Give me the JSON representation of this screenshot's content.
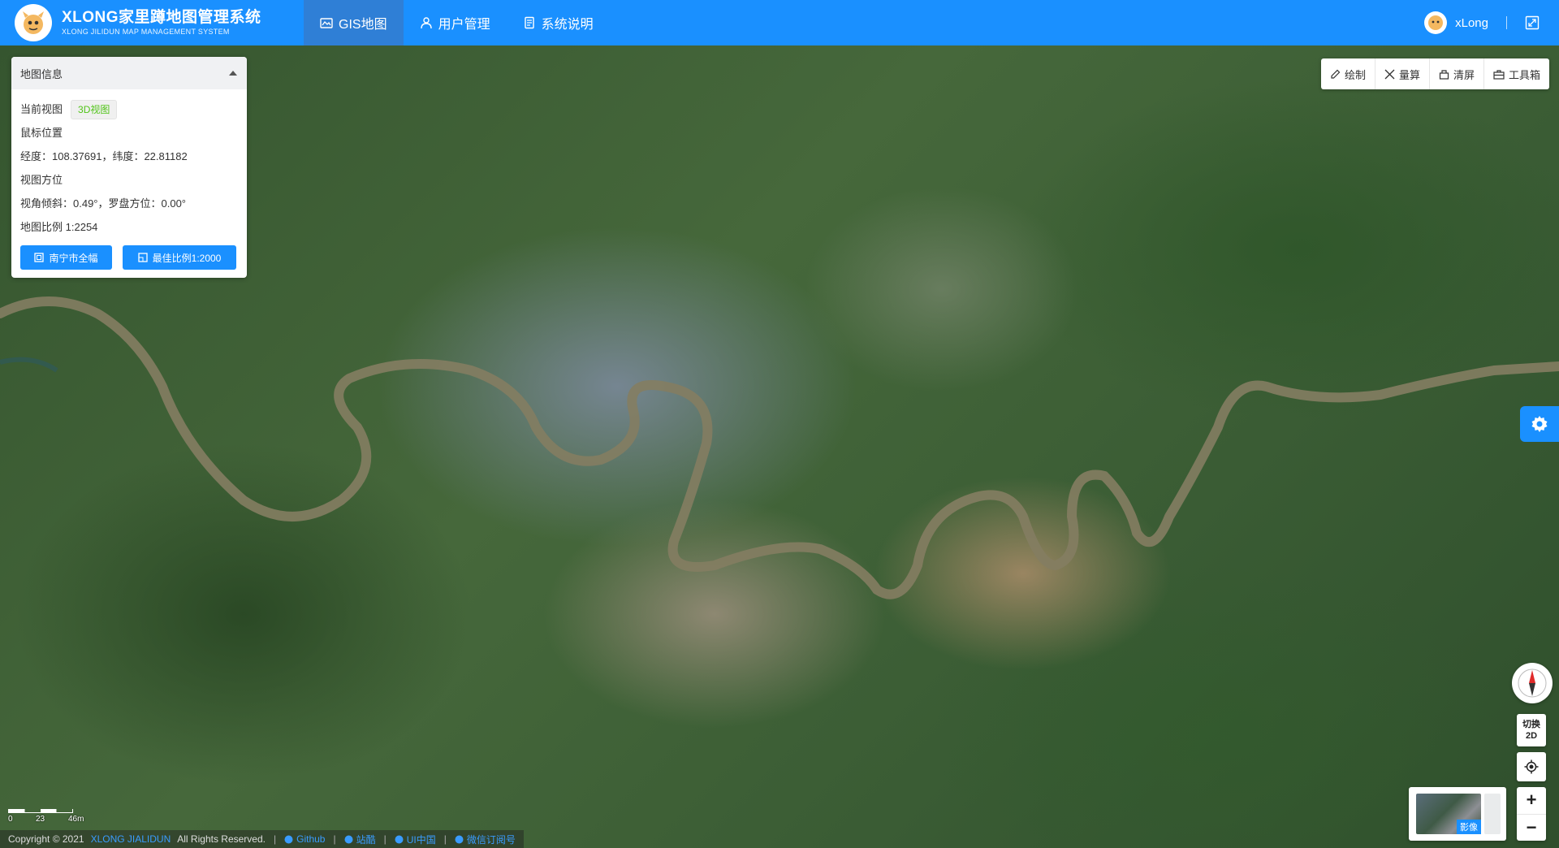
{
  "header": {
    "title": "XLONG家里蹲地图管理系统",
    "subtitle": "XLONG JILIDUN MAP MANAGEMENT SYSTEM",
    "nav": [
      {
        "label": "GIS地图",
        "icon": "map-icon",
        "active": true
      },
      {
        "label": "用户管理",
        "icon": "user-icon",
        "active": false
      },
      {
        "label": "系统说明",
        "icon": "document-icon",
        "active": false
      }
    ],
    "username": "xLong",
    "accent_color": "#1a90ff"
  },
  "info_panel": {
    "title": "地图信息",
    "current_view_label": "当前视图",
    "current_view_tag": "3D视图",
    "mouse_position_label": "鼠标位置",
    "coords": "经度：108.37691，纬度：22.81182",
    "view_orientation_label": "视图方位",
    "orientation": "视角倾斜：0.49°，罗盘方位：0.00°",
    "scale_label": "地图比例",
    "scale_value": "1:2254",
    "button_full_extent": "南宁市全幅",
    "button_best_scale": "最佳比例1:2000"
  },
  "toolbar": {
    "draw": "绘制",
    "measure": "量算",
    "clear": "清屏",
    "toolbox": "工具箱"
  },
  "controls": {
    "switch_line1": "切换",
    "switch_line2": "2D",
    "zoom_in": "+",
    "zoom_out": "−",
    "basemap_label": "影像"
  },
  "scalebar": {
    "labels": [
      "0",
      "23",
      "46m"
    ]
  },
  "footer": {
    "copyright": "Copyright © 2021",
    "brand": "XLONG JIALIDUN",
    "rights": "All Rights Reserved.",
    "links": [
      "Github",
      "站酷",
      "UI中国",
      "微信订阅号"
    ]
  }
}
